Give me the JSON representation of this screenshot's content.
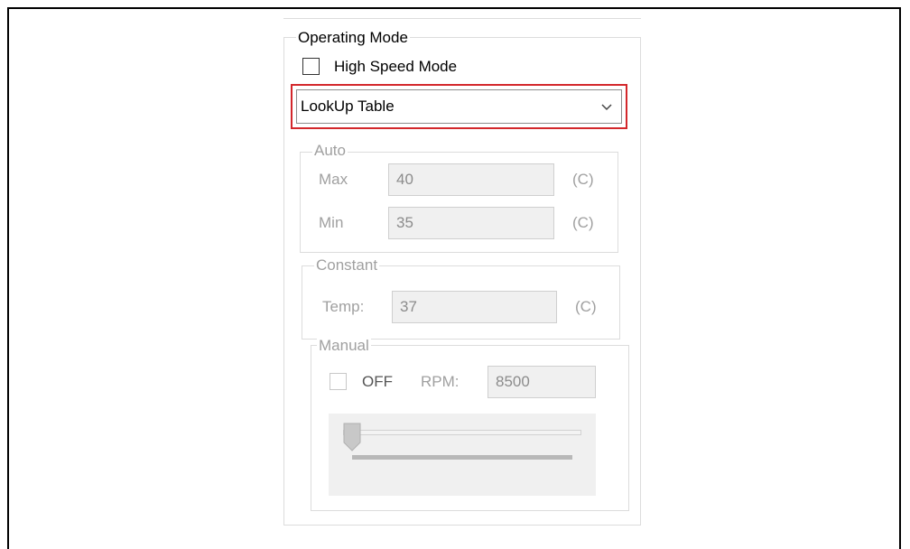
{
  "operating_mode": {
    "title": "Operating Mode",
    "high_speed_label": "High Speed Mode",
    "high_speed_checked": false,
    "mode_selected": "LookUp Table",
    "arrow_icon": "chevron-down-icon"
  },
  "auto": {
    "title": "Auto",
    "max_label": "Max",
    "max_value": "40",
    "max_unit": "(C)",
    "min_label": "Min",
    "min_value": "35",
    "min_unit": "(C)"
  },
  "constant": {
    "title": "Constant",
    "temp_label": "Temp:",
    "temp_value": "37",
    "temp_unit": "(C)"
  },
  "manual": {
    "title": "Manual",
    "off_label": "OFF",
    "off_checked": false,
    "rpm_label": "RPM:",
    "rpm_value": "8500",
    "slider_level": 0
  },
  "colors": {
    "highlight_border": "#d3272b",
    "disabled_text": "#a0a0a0",
    "disabled_field_bg": "#f0f0f0"
  }
}
